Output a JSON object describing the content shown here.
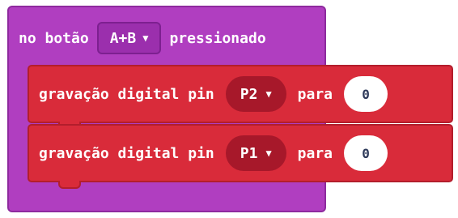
{
  "event": {
    "label_prefix": "no botão",
    "button_value": "A+B",
    "label_suffix": "pressionado"
  },
  "statements": [
    {
      "label": "gravação digital pin",
      "pin": "P2",
      "label_to": "para",
      "value": "0"
    },
    {
      "label": "gravação digital pin",
      "pin": "P1",
      "label_to": "para",
      "value": "0"
    }
  ],
  "icons": {
    "dropdown": "caret-down-icon"
  },
  "colors": {
    "event_block": "#b03ec0",
    "statement_block": "#d92b3a",
    "pin_dropdown": "#a7182a"
  }
}
